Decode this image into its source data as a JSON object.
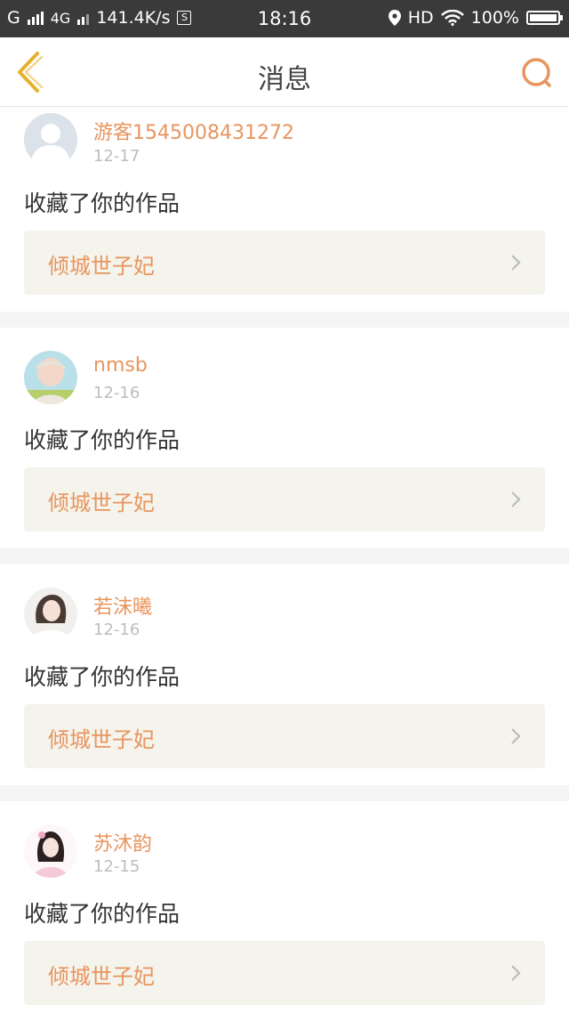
{
  "status_bar": {
    "carrier": "G",
    "network": "4G",
    "speed": "141.4K/s",
    "s_badge": "S",
    "time": "18:16",
    "hd": "HD",
    "battery": "100%"
  },
  "header": {
    "title": "消息",
    "back_icon": "chevron-left-icon",
    "search_icon": "search-icon"
  },
  "messages": [
    {
      "username": "游客1545008431272",
      "date": "12-17",
      "action": "收藏了你的作品",
      "work": "倾城世子妃"
    },
    {
      "username": "nmsb",
      "date": "12-16",
      "action": "收藏了你的作品",
      "work": "倾城世子妃"
    },
    {
      "username": "若沫曦",
      "date": "12-16",
      "action": "收藏了你的作品",
      "work": "倾城世子妃"
    },
    {
      "username": "苏沐韵",
      "date": "12-15",
      "action": "收藏了你的作品",
      "work": "倾城世子妃"
    }
  ],
  "colors": {
    "accent": "#e8955e",
    "back_arrow": "#e6b22e",
    "work_bg": "#f4f3ec",
    "status_bar_bg": "#3a3a3a"
  }
}
